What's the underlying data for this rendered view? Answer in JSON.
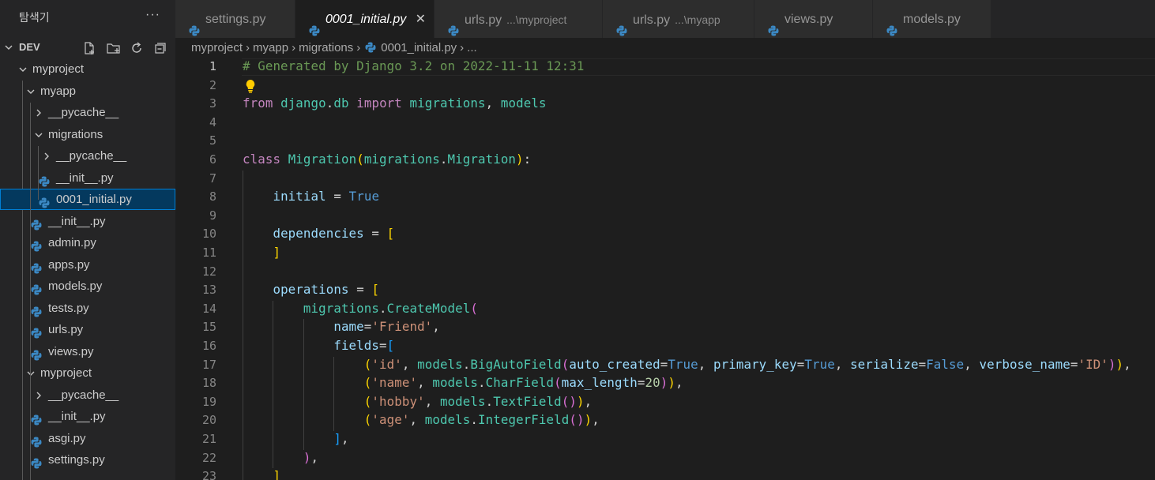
{
  "sidebar": {
    "title": "탐색기",
    "more": "···",
    "root": "DEV",
    "items": [
      {
        "label": "myproject",
        "type": "folder",
        "open": true
      },
      {
        "label": "myapp",
        "type": "folder",
        "open": true
      },
      {
        "label": "__pycache__",
        "type": "folder",
        "open": false
      },
      {
        "label": "migrations",
        "type": "folder",
        "open": true
      },
      {
        "label": "__pycache__",
        "type": "folder",
        "open": false
      },
      {
        "label": "__init__.py",
        "type": "file"
      },
      {
        "label": "0001_initial.py",
        "type": "file",
        "selected": true
      },
      {
        "label": "__init__.py",
        "type": "file"
      },
      {
        "label": "admin.py",
        "type": "file"
      },
      {
        "label": "apps.py",
        "type": "file"
      },
      {
        "label": "models.py",
        "type": "file"
      },
      {
        "label": "tests.py",
        "type": "file"
      },
      {
        "label": "urls.py",
        "type": "file"
      },
      {
        "label": "views.py",
        "type": "file"
      },
      {
        "label": "myproject",
        "type": "folder",
        "open": true
      },
      {
        "label": "__pycache__",
        "type": "folder",
        "open": false
      },
      {
        "label": "__init__.py",
        "type": "file"
      },
      {
        "label": "asgi.py",
        "type": "file"
      },
      {
        "label": "settings.py",
        "type": "file"
      }
    ]
  },
  "tabs": [
    {
      "label": "settings.py",
      "desc": ""
    },
    {
      "label": "0001_initial.py",
      "desc": "",
      "active": true,
      "close": "✕"
    },
    {
      "label": "urls.py",
      "desc": "...\\myproject"
    },
    {
      "label": "urls.py",
      "desc": "...\\myapp"
    },
    {
      "label": "views.py",
      "desc": ""
    },
    {
      "label": "models.py",
      "desc": ""
    }
  ],
  "breadcrumb": [
    "myproject",
    "myapp",
    "migrations",
    "0001_initial.py",
    "..."
  ],
  "editor": {
    "current_line": 1,
    "lines": [
      {
        "n": 1,
        "text": "# Generated by Django 3.2 on 2022-11-11 12:31"
      },
      {
        "n": 2,
        "text": ""
      },
      {
        "n": 3,
        "text": "from django.db import migrations, models"
      },
      {
        "n": 4,
        "text": ""
      },
      {
        "n": 5,
        "text": ""
      },
      {
        "n": 6,
        "text": "class Migration(migrations.Migration):"
      },
      {
        "n": 7,
        "text": ""
      },
      {
        "n": 8,
        "text": "    initial = True"
      },
      {
        "n": 9,
        "text": ""
      },
      {
        "n": 10,
        "text": "    dependencies = ["
      },
      {
        "n": 11,
        "text": "    ]"
      },
      {
        "n": 12,
        "text": ""
      },
      {
        "n": 13,
        "text": "    operations = ["
      },
      {
        "n": 14,
        "text": "        migrations.CreateModel("
      },
      {
        "n": 15,
        "text": "            name='Friend',"
      },
      {
        "n": 16,
        "text": "            fields=["
      },
      {
        "n": 17,
        "text": "                ('id', models.BigAutoField(auto_created=True, primary_key=True, serialize=False, verbose_name='ID')),"
      },
      {
        "n": 18,
        "text": "                ('name', models.CharField(max_length=20)),"
      },
      {
        "n": 19,
        "text": "                ('hobby', models.TextField()),"
      },
      {
        "n": 20,
        "text": "                ('age', models.IntegerField()),"
      },
      {
        "n": 21,
        "text": "            ],"
      },
      {
        "n": 22,
        "text": "        ),"
      },
      {
        "n": 23,
        "text": "    ]"
      }
    ]
  },
  "colors": {
    "editor_bg": "#1e1e1e",
    "sidebar_bg": "#252526",
    "selection": "#04395e",
    "focus_border": "#007fd4"
  }
}
